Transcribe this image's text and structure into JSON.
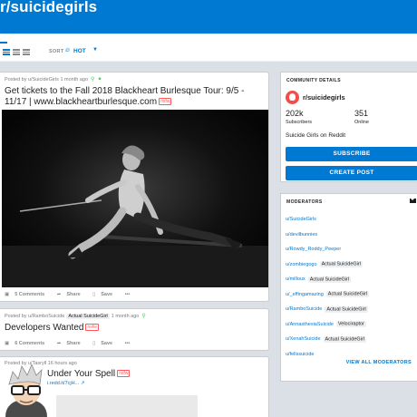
{
  "header": {
    "title": "r/suicidegirls",
    "accent": "#0079d3"
  },
  "sortbar": {
    "label": "SORT",
    "value": "HOT",
    "icons": [
      "card-view-icon",
      "classic-view-icon",
      "compact-view-icon",
      "flame-icon",
      "chevron-down-icon"
    ]
  },
  "posts": [
    {
      "meta": "Posted by u/SuicideGirls 1 month ago",
      "title": "Get tickets to the Fall 2018 Blackheart Burlesque Tour: 9/5 - 11/17 | www.blackheartburlesque.com",
      "nsfw": "nsfw",
      "actions": {
        "comments": "5 Comments",
        "share": "Share",
        "save": "Save",
        "more": "•••"
      }
    },
    {
      "meta_prefix": "Posted by u/RamboSuicide",
      "flair": "Actual SuicideGirl",
      "meta_suffix": "1 month ago",
      "title": "Developers Wanted",
      "nsfw": "nsfw",
      "actions": {
        "comments": "6 Comments",
        "share": "Share",
        "save": "Save",
        "more": "•••"
      }
    },
    {
      "meta": "Posted by u/Tasryll 16 hours ago",
      "title": "Under Your Spell",
      "nsfw": "nsfw",
      "link": "i.redd.it/7cjH..."
    }
  ],
  "community": {
    "header": "COMMUNITY DETAILS",
    "name": "r/suicidegirls",
    "subscribers": "202k",
    "subscribers_label": "Subscribers",
    "online": "351",
    "online_label": "Online",
    "description": "Suicide Girls on Reddit",
    "subscribe_label": "SUBSCRIBE",
    "create_post_label": "CREATE POST"
  },
  "moderators": {
    "header": "MODERATORS",
    "items": [
      {
        "name": "u/SuicideGirls",
        "flair": ""
      },
      {
        "name": "u/devilbunnies",
        "flair": ""
      },
      {
        "name": "u/Rowdy_Roddy_Peeper",
        "flair": ""
      },
      {
        "name": "u/zombiegogo",
        "flair": "Actual SuicideGirl"
      },
      {
        "name": "u/milloux",
        "flair": "Actual SuicideGirl"
      },
      {
        "name": "u/_effingamazing",
        "flair": "Actual SuicideGirl"
      },
      {
        "name": "u/RamboSuicide",
        "flair": "Actual SuicideGirl"
      },
      {
        "name": "u/AnnasthesiaSuicide",
        "flair": "Velociraptor"
      },
      {
        "name": "u/XenahSuicide",
        "flair": "Actual SuicideGirl"
      },
      {
        "name": "u/fellssuicide",
        "flair": ""
      }
    ],
    "view_all": "VIEW ALL MODERATORS"
  }
}
